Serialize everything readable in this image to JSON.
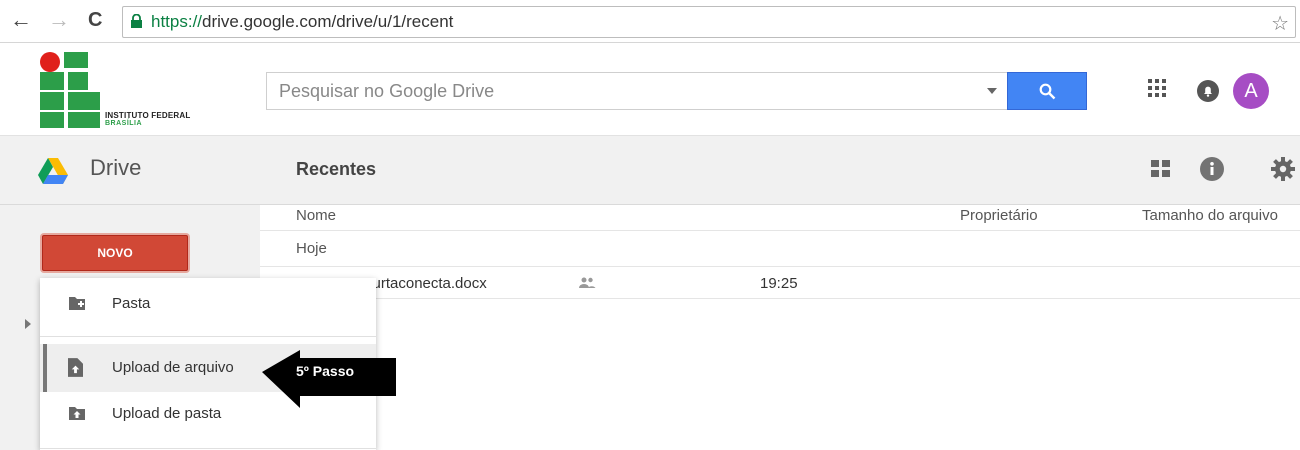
{
  "browser": {
    "url_scheme": "https://",
    "url_rest": "drive.google.com/drive/u/1/recent",
    "back_glyph": "←",
    "forward_glyph": "→",
    "reload_glyph": "C",
    "star_glyph": "☆"
  },
  "org_logo": {
    "line1": "INSTITUTO FEDERAL",
    "line2": "BRASÍLIA"
  },
  "header": {
    "search_placeholder": "Pesquisar no Google Drive",
    "avatar_letter": "A"
  },
  "drive_bar": {
    "app_name": "Drive",
    "page_title": "Recentes"
  },
  "sidebar": {
    "new_button_label": "NOVO"
  },
  "list": {
    "columns": [
      "Nome",
      "Proprietário",
      "Tamanho do arquivo"
    ],
    "group_label": "Hoje",
    "rows": [
      {
        "name": "stracurtaconecta.docx",
        "time": "19:25"
      }
    ]
  },
  "new_menu": {
    "items": [
      {
        "label": "Pasta",
        "icon": "folder-plus-icon"
      },
      {
        "label": "Upload de arquivo",
        "icon": "file-upload-icon"
      },
      {
        "label": "Upload de pasta",
        "icon": "folder-upload-icon"
      }
    ]
  },
  "annotation": {
    "label": "5º Passo"
  },
  "colors": {
    "search_button": "#4285f4",
    "new_button": "#d14836",
    "avatar": "#a64dc4",
    "logo_green": "#2c9e49",
    "logo_red": "#e0201b"
  }
}
